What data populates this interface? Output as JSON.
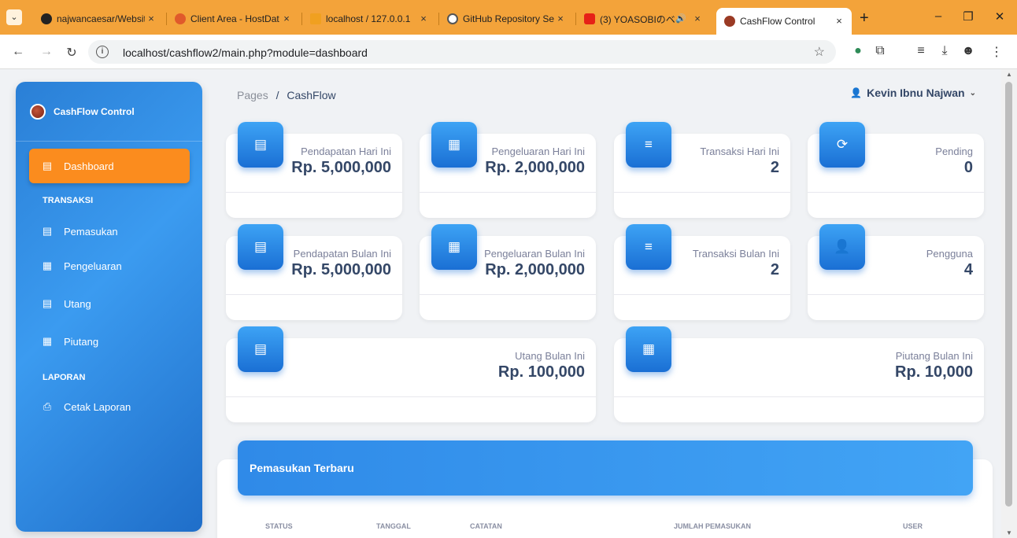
{
  "browser": {
    "tabs": [
      {
        "title": "najwancaesar/Websit",
        "icon_color": "#222222",
        "active": false
      },
      {
        "title": "Client Area - HostDat",
        "icon_color": "#e05a2b",
        "active": false
      },
      {
        "title": "localhost / 127.0.0.1",
        "icon_color": "#f0a020",
        "active": false
      },
      {
        "title": "GitHub Repository Se",
        "icon_color": "#555555",
        "active": false
      },
      {
        "title": "(3) YOASOBIのベ",
        "icon_color": "#e62117",
        "active": false
      },
      {
        "title": "CashFlow Control",
        "icon_color": "#9a3a24",
        "active": true
      }
    ],
    "tab_close": "×",
    "new_tab": "+",
    "url": "localhost/cashflow2/main.php?module=dashboard",
    "info_icon": "i",
    "star": "☆"
  },
  "app": {
    "name": "CashFlow Control",
    "breadcrumb_root": "Pages",
    "breadcrumb_sep": "/",
    "breadcrumb_current": "CashFlow",
    "user_name": "Kevin Ibnu Najwan",
    "accent_color": "#fb8c1e",
    "primary_color": "#2a7fd6"
  },
  "sidebar": {
    "dashboard": "Dashboard",
    "section_transaksi": "TRANSAKSI",
    "items": [
      "Pemasukan",
      "Pengeluaran",
      "Utang",
      "Piutang"
    ],
    "section_laporan": "LAPORAN",
    "cetak": "Cetak Laporan"
  },
  "cards": [
    {
      "label": "Pendapatan Hari Ini",
      "value": "Rp. 5,000,000",
      "icon": "wallet-icon"
    },
    {
      "label": "Pengeluaran Hari Ini",
      "value": "Rp. 2,000,000",
      "icon": "receipt-icon"
    },
    {
      "label": "Transaksi Hari Ini",
      "value": "2",
      "icon": "list-icon"
    },
    {
      "label": "Pending",
      "value": "0",
      "icon": "refresh-icon"
    },
    {
      "label": "Pendapatan Bulan Ini",
      "value": "Rp. 5,000,000",
      "icon": "wallet-icon"
    },
    {
      "label": "Pengeluaran Bulan Ini",
      "value": "Rp. 2,000,000",
      "icon": "receipt-icon"
    },
    {
      "label": "Transaksi Bulan Ini",
      "value": "2",
      "icon": "list-icon"
    },
    {
      "label": "Pengguna",
      "value": "4",
      "icon": "user-icon"
    },
    {
      "label": "Utang Bulan Ini",
      "value": "Rp. 100,000",
      "icon": "wallet-icon"
    },
    {
      "label": "Piutang Bulan Ini",
      "value": "Rp. 10,000",
      "icon": "receipt-icon"
    }
  ],
  "table": {
    "title": "Pemasukan Terbaru",
    "columns": [
      "STATUS",
      "TANGGAL",
      "CATATAN",
      "JUMLAH PEMASUKAN",
      "USER"
    ]
  }
}
